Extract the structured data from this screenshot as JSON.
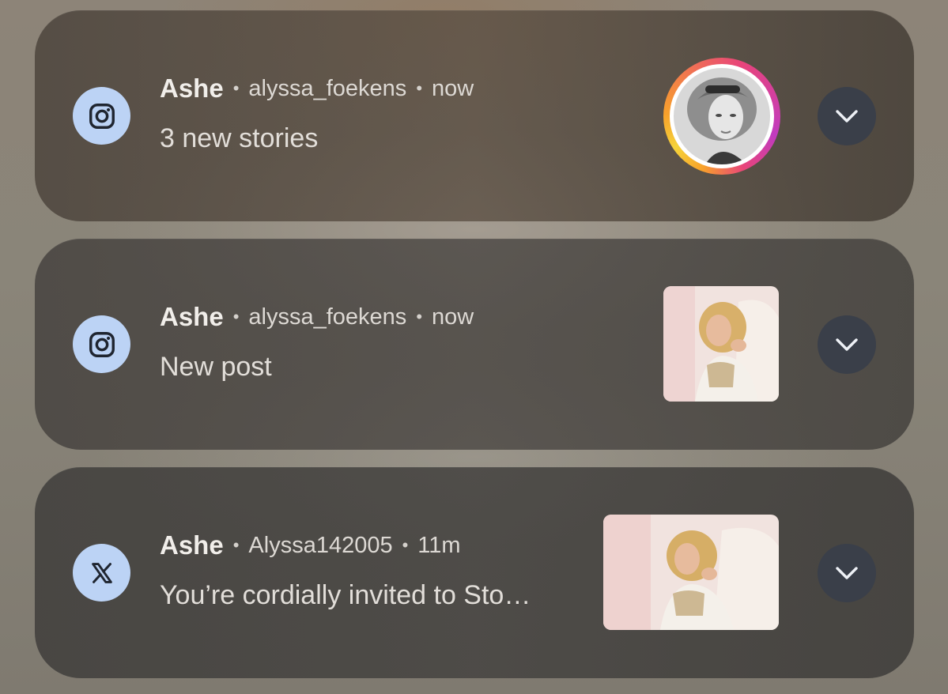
{
  "notifications": [
    {
      "app_icon": "instagram-icon",
      "name": "Ashe",
      "account": "alyssa_foekens",
      "time": "now",
      "text": "3 new stories",
      "media": "story-avatar"
    },
    {
      "app_icon": "instagram-icon",
      "name": "Ashe",
      "account": "alyssa_foekens",
      "time": "now",
      "text": "New post",
      "media": "post-thumbnail"
    },
    {
      "app_icon": "x-icon",
      "name": "Ashe",
      "account": "Alyssa142005",
      "time": "11m",
      "text": "You’re cordially invited to Sto…",
      "media": "post-thumbnail"
    }
  ],
  "separator": "•",
  "colors": {
    "icon_bg": "#bcd3f5",
    "expand_button_bg": "#3a3f49",
    "story_ring_start": "#f8a12b",
    "story_ring_end": "#c13bbf"
  }
}
